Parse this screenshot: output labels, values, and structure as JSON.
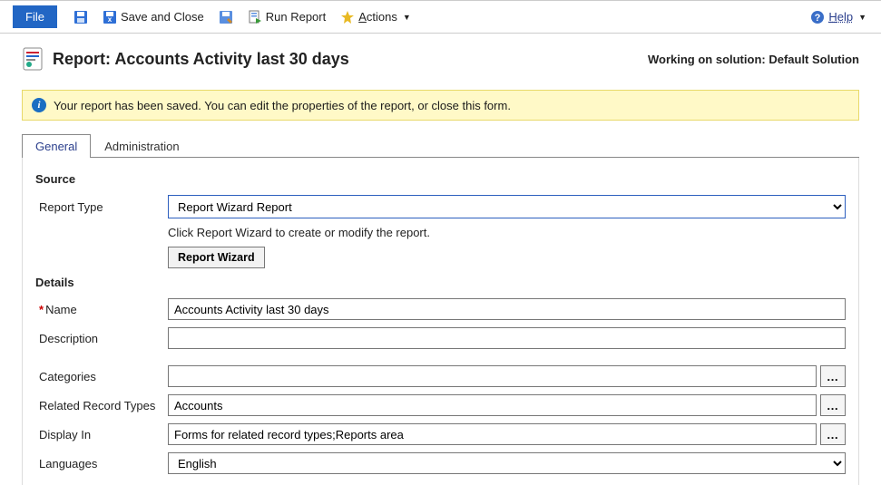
{
  "toolbar": {
    "file_label": "File",
    "save_and_close_label": "Save and Close",
    "run_report_label": "Run Report",
    "actions_label": "Actions",
    "help_label": "Help"
  },
  "header": {
    "title": "Report: Accounts Activity last 30 days",
    "solution_prefix": "Working on solution: ",
    "solution_name": "Default Solution"
  },
  "info_bar": {
    "message": "Your report has been saved. You can edit the properties of the report, or close this form."
  },
  "tabs": {
    "general": "General",
    "administration": "Administration",
    "active": "general"
  },
  "form": {
    "source": {
      "section_title": "Source",
      "report_type_label": "Report Type",
      "report_type_value": "Report Wizard Report",
      "hint": "Click Report Wizard to create or modify the report.",
      "wizard_button": "Report Wizard"
    },
    "details": {
      "section_title": "Details",
      "name_label": "Name",
      "name_value": "Accounts Activity last 30 days",
      "description_label": "Description",
      "description_value": "",
      "categories_label": "Categories",
      "categories_value": "",
      "related_label": "Related Record Types",
      "related_value": "Accounts",
      "display_in_label": "Display In",
      "display_in_value": "Forms for related record types;Reports area",
      "languages_label": "Languages",
      "languages_value": "English"
    }
  }
}
